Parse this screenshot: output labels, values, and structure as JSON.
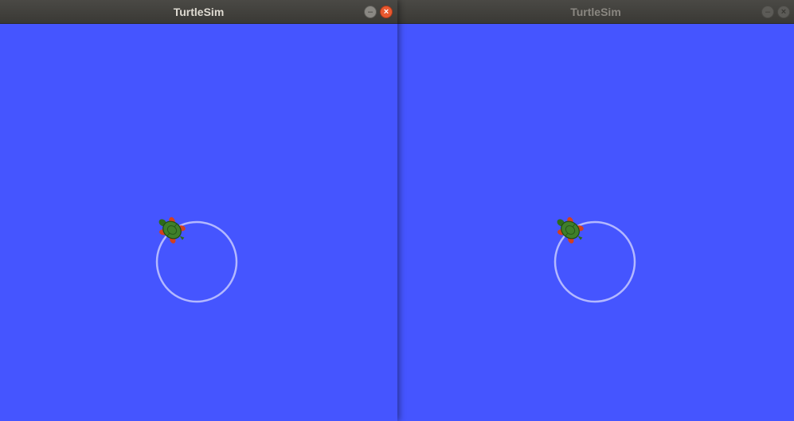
{
  "windows": [
    {
      "title": "TurtleSim",
      "state": "focused",
      "background_color": "#4555ff",
      "pen_color": "#b3b8ff",
      "controls": {
        "minimize_icon": "minimize-icon",
        "close_icon": "close-icon"
      }
    },
    {
      "title": "TurtleSim",
      "state": "inactive",
      "background_color": "#4555ff",
      "pen_color": "#b3b8ff",
      "controls": {
        "minimize_icon": "minimize-icon",
        "close_icon": "close-icon"
      }
    }
  ],
  "colors": {
    "titlebar": "#3d3c38",
    "close_active": "#e9582f",
    "turtle_shell": "#3f7f2a",
    "turtle_skin": "#2e6a1c",
    "turtle_feet": "#d2401f"
  }
}
